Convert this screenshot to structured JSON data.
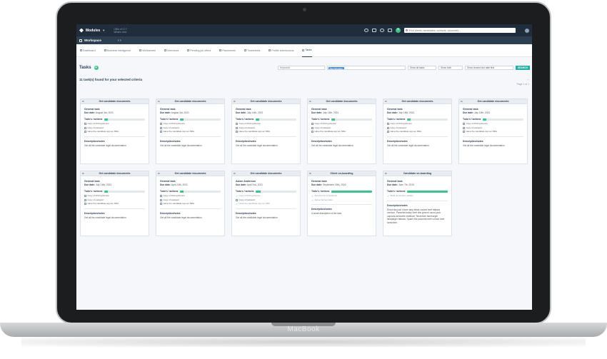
{
  "brand": "MacBook",
  "topbar": {
    "modules_label": "Modules",
    "version_line1": "Cliflo v2.2.7",
    "version_line2": "What's new",
    "search_placeholder": "Find clients, candidates, contacts, vacancies..."
  },
  "workspace": {
    "label": "Workspace"
  },
  "nav": {
    "tabs": [
      "Dashboard",
      "Business intelligence",
      "Worksheets",
      "Interviews",
      "Pending job offers",
      "Placements",
      "Timesheets",
      "Profile submissions",
      "Tasks"
    ],
    "active": "Tasks"
  },
  "tasks": {
    "title": "Tasks",
    "found": "11 task(s) found for your selected criteria",
    "page": "Page 1 of 1",
    "filters": {
      "keywords_placeholder": "Keywords",
      "assignee_tag": "Alex Mcvalley",
      "status": "Show all tasks",
      "type": "Show both",
      "sort": "Show closest due date first",
      "search_button": "SEARCH"
    }
  },
  "labels": {
    "todos": "Todo's / actions",
    "description": "Description/notes",
    "due_prefix": "Due date:"
  },
  "cards": [
    {
      "title": "Get candidate documents",
      "type": "General task",
      "due": "August 3rd, 2021",
      "progress": 8,
      "items": [
        {
          "text": "Copy of driving licence",
          "done": false
        },
        {
          "text": "Copy of passport",
          "done": false
        },
        {
          "text": "Have the candidate sign an NDA",
          "done": false
        }
      ],
      "description": "Get all the candidate legal documentation"
    },
    {
      "title": "Get candidate documents",
      "type": "General task",
      "due": "August 3rd, 2021",
      "progress": 8,
      "items": [
        {
          "text": "Copy of driving licence",
          "done": false
        },
        {
          "text": "Copy of passport",
          "done": false
        },
        {
          "text": "Have the candidate sign an NDA",
          "done": false
        }
      ],
      "description": "Get all the candidate legal documentation"
    },
    {
      "title": "Get candidate documents",
      "type": "General task",
      "due": "July 14th, 2021",
      "progress": 8,
      "items": [
        {
          "text": "Copy of driving licence",
          "done": false
        },
        {
          "text": "Copy of passport",
          "done": false
        },
        {
          "text": "Have the candidate sign an NDA",
          "done": false
        }
      ],
      "description": "Get all the candidate legal documentation"
    },
    {
      "title": "Get candidate documents",
      "type": "General task",
      "due": "July 14th, 2021",
      "progress": 8,
      "items": [
        {
          "text": "Copy of driving licence",
          "done": false
        },
        {
          "text": "Copy of passport",
          "done": false
        },
        {
          "text": "Have the candidate sign an NDA",
          "done": false
        }
      ],
      "description": "Get all the candidate legal documentation"
    },
    {
      "title": "Get candidate documents",
      "type": "General task",
      "due": "July 14th, 2021",
      "progress": 8,
      "items": [
        {
          "text": "Copy of driving licence",
          "done": false
        },
        {
          "text": "Copy of passport",
          "done": false
        },
        {
          "text": "Have the candidate sign an NDA",
          "done": false
        }
      ],
      "description": "Get all the candidate legal documentation"
    },
    {
      "title": "Get candidate documents",
      "type": "General task",
      "due": "July 14th, 2021",
      "progress": 8,
      "items": [
        {
          "text": "Copy of driving licence",
          "done": false
        },
        {
          "text": "Copy of passport",
          "done": false
        },
        {
          "text": "Have the candidate sign an NDA",
          "done": false
        }
      ],
      "description": "Get all the candidate legal documentation"
    },
    {
      "title": "Get candidate documents",
      "type": "General task",
      "due": "July 14th, 2021",
      "progress": 8,
      "items": [
        {
          "text": "Copy of driving licence",
          "done": false
        },
        {
          "text": "Copy of passport",
          "done": false
        },
        {
          "text": "Have the candidate sign an NDA",
          "done": false
        }
      ],
      "description": "Get all the candidate legal documentation"
    },
    {
      "title": "Get candidate documents",
      "type": "General task",
      "due": "April 24th, 2021",
      "progress": 8,
      "items": [
        {
          "text": "Copy of driving licence",
          "done": false
        },
        {
          "text": "Copy of passport",
          "done": false
        },
        {
          "text": "Have the candidate sign an NDA",
          "done": false
        }
      ],
      "description": "Get all the candidate legal documentation"
    },
    {
      "title": "Get candidate documents",
      "type": "Aaron Anderson",
      "due": "April 2nd, 2021",
      "progress": 12,
      "items": [
        {
          "text": "Copy of driving licence",
          "done": true
        },
        {
          "text": "Copy of passport",
          "done": false
        },
        {
          "text": "Have the candidate sign an NDA",
          "done": true
        }
      ],
      "description": "Get all the candidate legal documentation"
    },
    {
      "title": "Client on-boarding",
      "type": "General task",
      "due": "September 30th, 2020",
      "progress": 100,
      "items": [
        {
          "text": "Send terms of business",
          "done": true
        },
        {
          "text": "Agree flat fee rates",
          "done": true
        }
      ],
      "description": "A small description of the task"
    },
    {
      "title": "Candidate on-boarding",
      "type": "General task",
      "due": "June 7th, 2019",
      "progress": 100,
      "items": [
        {
          "text": "Build up student rotation",
          "done": true
        }
      ],
      "description": "Short ribs jowl t-bone strip steak corned beef fatback venison. Pancetta turkey beef ribs ground round pork capicola andouille meatloaf. Tenderloin hamburger landjaeger fatback. Spare ribs pancetta beef corned beef turducken."
    }
  ]
}
